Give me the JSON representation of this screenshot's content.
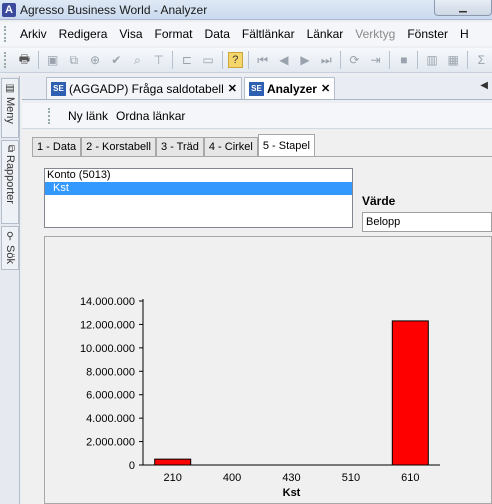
{
  "window": {
    "title": "Agresso Business World - Analyzer",
    "app_icon": "A"
  },
  "menu": [
    {
      "label": "Arkiv",
      "disabled": false
    },
    {
      "label": "Redigera",
      "disabled": false
    },
    {
      "label": "Visa",
      "disabled": false
    },
    {
      "label": "Format",
      "disabled": false
    },
    {
      "label": "Data",
      "disabled": false
    },
    {
      "label": "Fältlänkar",
      "disabled": false
    },
    {
      "label": "Länkar",
      "disabled": false
    },
    {
      "label": "Verktyg",
      "disabled": true
    },
    {
      "label": "Fönster",
      "disabled": false
    },
    {
      "label": "H",
      "disabled": false
    }
  ],
  "sidebar": {
    "tabs": [
      "Meny",
      "Rapporter",
      "Sök"
    ]
  },
  "doc_tabs": [
    {
      "icon": "SE",
      "label": "(AGGADP) Fråga saldotabell",
      "close": "✕",
      "active": false
    },
    {
      "icon": "SE",
      "label": "Analyzer",
      "close": "✕",
      "active": true
    }
  ],
  "links_bar": {
    "items": [
      "Ny länk",
      "Ordna länkar"
    ]
  },
  "sub_tabs": [
    "1 - Data",
    "2 - Korstabell",
    "3 - Träd",
    "4 - Cirkel",
    "5 - Stapel"
  ],
  "active_sub_tab": 4,
  "list": {
    "items": [
      "Konto (5013)",
      "Kst"
    ],
    "selected": 1
  },
  "value_field": {
    "label": "Värde",
    "selected": "Belopp"
  },
  "colors": {
    "bar": "#ff0000",
    "selection": "#3399ff",
    "accent": "#2f5fb0"
  },
  "chart_data": {
    "type": "bar",
    "categories": [
      "210",
      "400",
      "430",
      "510",
      "610"
    ],
    "values": [
      500000,
      0,
      0,
      0,
      12300000
    ],
    "xlabel": "Kst",
    "ylabel": "",
    "ylim": [
      0,
      14000000
    ],
    "yticks": [
      0,
      2000000,
      4000000,
      6000000,
      8000000,
      10000000,
      12000000,
      14000000
    ],
    "ytick_labels": [
      "0",
      "2.000.000",
      "4.000.000",
      "6.000.000",
      "8.000.000",
      "10.000.000",
      "12.000.000",
      "14.000.000"
    ],
    "grid": false,
    "bar_color": "#ff0000"
  }
}
